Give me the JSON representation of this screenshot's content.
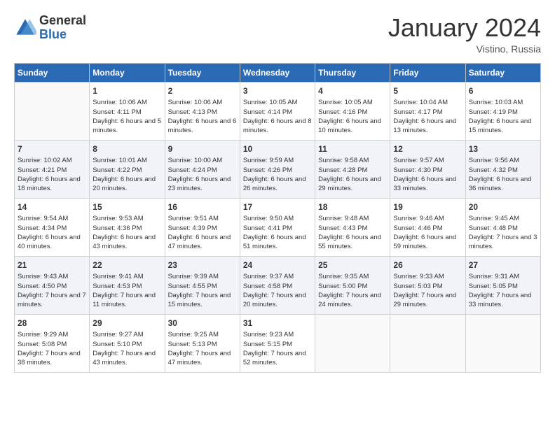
{
  "header": {
    "logo_general": "General",
    "logo_blue": "Blue",
    "month_title": "January 2024",
    "location": "Vistino, Russia"
  },
  "days_of_week": [
    "Sunday",
    "Monday",
    "Tuesday",
    "Wednesday",
    "Thursday",
    "Friday",
    "Saturday"
  ],
  "weeks": [
    [
      {
        "day": "",
        "sunrise": "",
        "sunset": "",
        "daylight": ""
      },
      {
        "day": "1",
        "sunrise": "Sunrise: 10:06 AM",
        "sunset": "Sunset: 4:11 PM",
        "daylight": "Daylight: 6 hours and 5 minutes."
      },
      {
        "day": "2",
        "sunrise": "Sunrise: 10:06 AM",
        "sunset": "Sunset: 4:13 PM",
        "daylight": "Daylight: 6 hours and 6 minutes."
      },
      {
        "day": "3",
        "sunrise": "Sunrise: 10:05 AM",
        "sunset": "Sunset: 4:14 PM",
        "daylight": "Daylight: 6 hours and 8 minutes."
      },
      {
        "day": "4",
        "sunrise": "Sunrise: 10:05 AM",
        "sunset": "Sunset: 4:16 PM",
        "daylight": "Daylight: 6 hours and 10 minutes."
      },
      {
        "day": "5",
        "sunrise": "Sunrise: 10:04 AM",
        "sunset": "Sunset: 4:17 PM",
        "daylight": "Daylight: 6 hours and 13 minutes."
      },
      {
        "day": "6",
        "sunrise": "Sunrise: 10:03 AM",
        "sunset": "Sunset: 4:19 PM",
        "daylight": "Daylight: 6 hours and 15 minutes."
      }
    ],
    [
      {
        "day": "7",
        "sunrise": "Sunrise: 10:02 AM",
        "sunset": "Sunset: 4:21 PM",
        "daylight": "Daylight: 6 hours and 18 minutes."
      },
      {
        "day": "8",
        "sunrise": "Sunrise: 10:01 AM",
        "sunset": "Sunset: 4:22 PM",
        "daylight": "Daylight: 6 hours and 20 minutes."
      },
      {
        "day": "9",
        "sunrise": "Sunrise: 10:00 AM",
        "sunset": "Sunset: 4:24 PM",
        "daylight": "Daylight: 6 hours and 23 minutes."
      },
      {
        "day": "10",
        "sunrise": "Sunrise: 9:59 AM",
        "sunset": "Sunset: 4:26 PM",
        "daylight": "Daylight: 6 hours and 26 minutes."
      },
      {
        "day": "11",
        "sunrise": "Sunrise: 9:58 AM",
        "sunset": "Sunset: 4:28 PM",
        "daylight": "Daylight: 6 hours and 29 minutes."
      },
      {
        "day": "12",
        "sunrise": "Sunrise: 9:57 AM",
        "sunset": "Sunset: 4:30 PM",
        "daylight": "Daylight: 6 hours and 33 minutes."
      },
      {
        "day": "13",
        "sunrise": "Sunrise: 9:56 AM",
        "sunset": "Sunset: 4:32 PM",
        "daylight": "Daylight: 6 hours and 36 minutes."
      }
    ],
    [
      {
        "day": "14",
        "sunrise": "Sunrise: 9:54 AM",
        "sunset": "Sunset: 4:34 PM",
        "daylight": "Daylight: 6 hours and 40 minutes."
      },
      {
        "day": "15",
        "sunrise": "Sunrise: 9:53 AM",
        "sunset": "Sunset: 4:36 PM",
        "daylight": "Daylight: 6 hours and 43 minutes."
      },
      {
        "day": "16",
        "sunrise": "Sunrise: 9:51 AM",
        "sunset": "Sunset: 4:39 PM",
        "daylight": "Daylight: 6 hours and 47 minutes."
      },
      {
        "day": "17",
        "sunrise": "Sunrise: 9:50 AM",
        "sunset": "Sunset: 4:41 PM",
        "daylight": "Daylight: 6 hours and 51 minutes."
      },
      {
        "day": "18",
        "sunrise": "Sunrise: 9:48 AM",
        "sunset": "Sunset: 4:43 PM",
        "daylight": "Daylight: 6 hours and 55 minutes."
      },
      {
        "day": "19",
        "sunrise": "Sunrise: 9:46 AM",
        "sunset": "Sunset: 4:46 PM",
        "daylight": "Daylight: 6 hours and 59 minutes."
      },
      {
        "day": "20",
        "sunrise": "Sunrise: 9:45 AM",
        "sunset": "Sunset: 4:48 PM",
        "daylight": "Daylight: 7 hours and 3 minutes."
      }
    ],
    [
      {
        "day": "21",
        "sunrise": "Sunrise: 9:43 AM",
        "sunset": "Sunset: 4:50 PM",
        "daylight": "Daylight: 7 hours and 7 minutes."
      },
      {
        "day": "22",
        "sunrise": "Sunrise: 9:41 AM",
        "sunset": "Sunset: 4:53 PM",
        "daylight": "Daylight: 7 hours and 11 minutes."
      },
      {
        "day": "23",
        "sunrise": "Sunrise: 9:39 AM",
        "sunset": "Sunset: 4:55 PM",
        "daylight": "Daylight: 7 hours and 15 minutes."
      },
      {
        "day": "24",
        "sunrise": "Sunrise: 9:37 AM",
        "sunset": "Sunset: 4:58 PM",
        "daylight": "Daylight: 7 hours and 20 minutes."
      },
      {
        "day": "25",
        "sunrise": "Sunrise: 9:35 AM",
        "sunset": "Sunset: 5:00 PM",
        "daylight": "Daylight: 7 hours and 24 minutes."
      },
      {
        "day": "26",
        "sunrise": "Sunrise: 9:33 AM",
        "sunset": "Sunset: 5:03 PM",
        "daylight": "Daylight: 7 hours and 29 minutes."
      },
      {
        "day": "27",
        "sunrise": "Sunrise: 9:31 AM",
        "sunset": "Sunset: 5:05 PM",
        "daylight": "Daylight: 7 hours and 33 minutes."
      }
    ],
    [
      {
        "day": "28",
        "sunrise": "Sunrise: 9:29 AM",
        "sunset": "Sunset: 5:08 PM",
        "daylight": "Daylight: 7 hours and 38 minutes."
      },
      {
        "day": "29",
        "sunrise": "Sunrise: 9:27 AM",
        "sunset": "Sunset: 5:10 PM",
        "daylight": "Daylight: 7 hours and 43 minutes."
      },
      {
        "day": "30",
        "sunrise": "Sunrise: 9:25 AM",
        "sunset": "Sunset: 5:13 PM",
        "daylight": "Daylight: 7 hours and 47 minutes."
      },
      {
        "day": "31",
        "sunrise": "Sunrise: 9:23 AM",
        "sunset": "Sunset: 5:15 PM",
        "daylight": "Daylight: 7 hours and 52 minutes."
      },
      {
        "day": "",
        "sunrise": "",
        "sunset": "",
        "daylight": ""
      },
      {
        "day": "",
        "sunrise": "",
        "sunset": "",
        "daylight": ""
      },
      {
        "day": "",
        "sunrise": "",
        "sunset": "",
        "daylight": ""
      }
    ]
  ]
}
